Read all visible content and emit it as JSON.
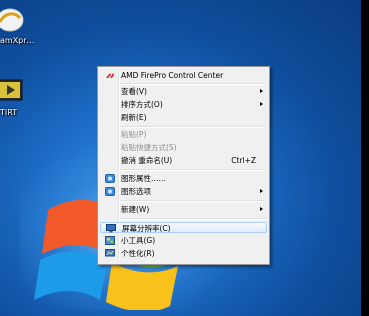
{
  "desktop": {
    "icons": [
      {
        "label": "amXpr…"
      },
      {
        "label": "TIRT"
      }
    ]
  },
  "menu": {
    "items": [
      {
        "label": "AMD FirePro Control Center",
        "icon": "amd-icon"
      },
      {
        "label": "查看(V)",
        "submenu": true
      },
      {
        "label": "排序方式(O)",
        "submenu": true
      },
      {
        "label": "刷新(E)"
      },
      {
        "label": "粘贴(P)",
        "disabled": true
      },
      {
        "label": "粘贴快捷方式(S)",
        "disabled": true
      },
      {
        "label": "撤消 重命名(U)",
        "shortcut": "Ctrl+Z"
      },
      {
        "label": "图形属性……",
        "icon": "graphics-icon"
      },
      {
        "label": "图形选项",
        "icon": "graphics-icon",
        "submenu": true
      },
      {
        "label": "新建(W)",
        "submenu": true
      },
      {
        "label": "屏幕分辨率(C)",
        "icon": "monitor-icon",
        "highlighted": true
      },
      {
        "label": "小工具(G)",
        "icon": "gadgets-icon"
      },
      {
        "label": "个性化(R)",
        "icon": "personalize-icon"
      }
    ]
  }
}
